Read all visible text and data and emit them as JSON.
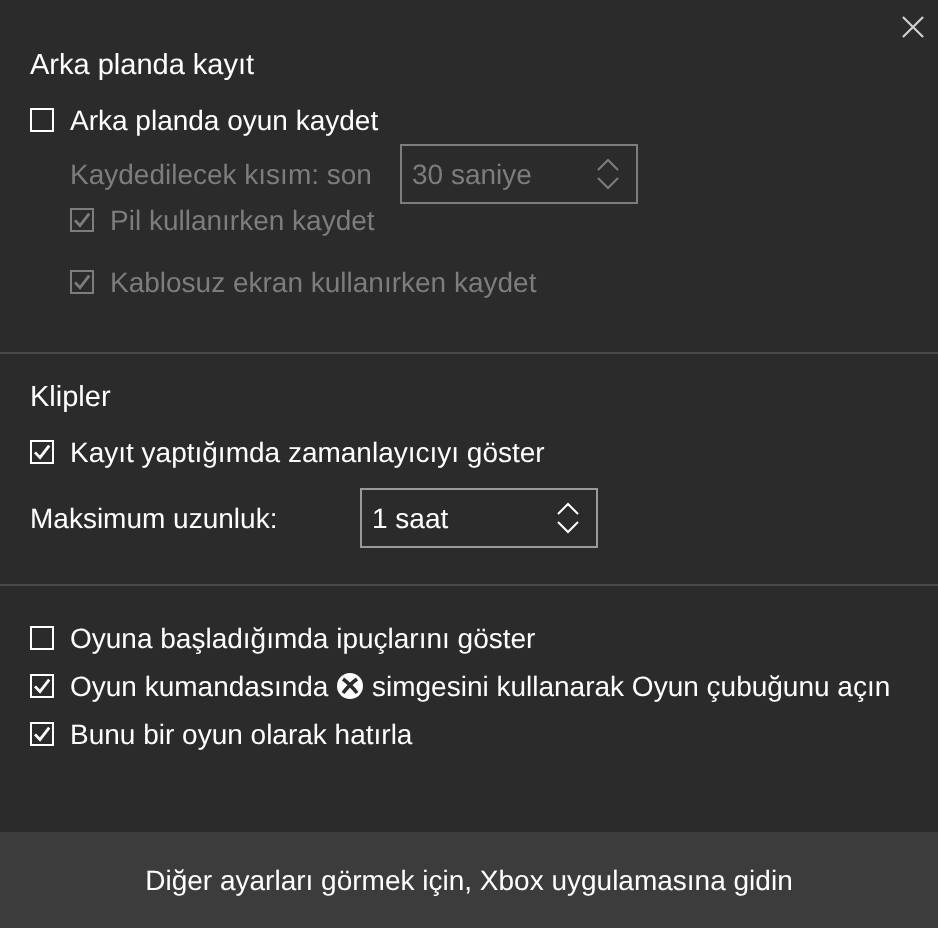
{
  "sections": [
    {
      "title": "Arka planda kayıt",
      "items": [
        {
          "kind": "checkbox",
          "label": "Arka planda oyun kaydet",
          "checked": false,
          "disabled": false,
          "children": [
            {
              "kind": "spinner",
              "label": "Kaydedilecek kısım: son",
              "value": "30 saniye",
              "disabled": true
            },
            {
              "kind": "checkbox",
              "label": "Pil kullanırken kaydet",
              "checked": true,
              "disabled": true
            },
            {
              "kind": "checkbox",
              "label": "Kablosuz ekran kullanırken kaydet",
              "checked": true,
              "disabled": true
            }
          ]
        }
      ]
    },
    {
      "title": "Klipler",
      "items": [
        {
          "kind": "checkbox",
          "label": "Kayıt yaptığımda zamanlayıcıyı göster",
          "checked": true,
          "disabled": false
        },
        {
          "kind": "spinner",
          "label": "Maksimum uzunluk:",
          "value": "1 saat",
          "disabled": false
        }
      ]
    },
    {
      "items": [
        {
          "kind": "checkbox",
          "label": "Oyuna başladığımda ipuçlarını göster",
          "checked": false,
          "disabled": false
        },
        {
          "kind": "checkbox",
          "label": "Oyun kumandasında",
          "label_after": "simgesini kullanarak Oyun çubuğunu açın",
          "checked": true,
          "disabled": false
        },
        {
          "kind": "checkbox",
          "label": "Bunu bir oyun olarak hatırla",
          "checked": true,
          "disabled": false
        }
      ]
    }
  ],
  "footer": {
    "link": "Diğer ayarları görmek için, Xbox uygulamasına gidin"
  }
}
